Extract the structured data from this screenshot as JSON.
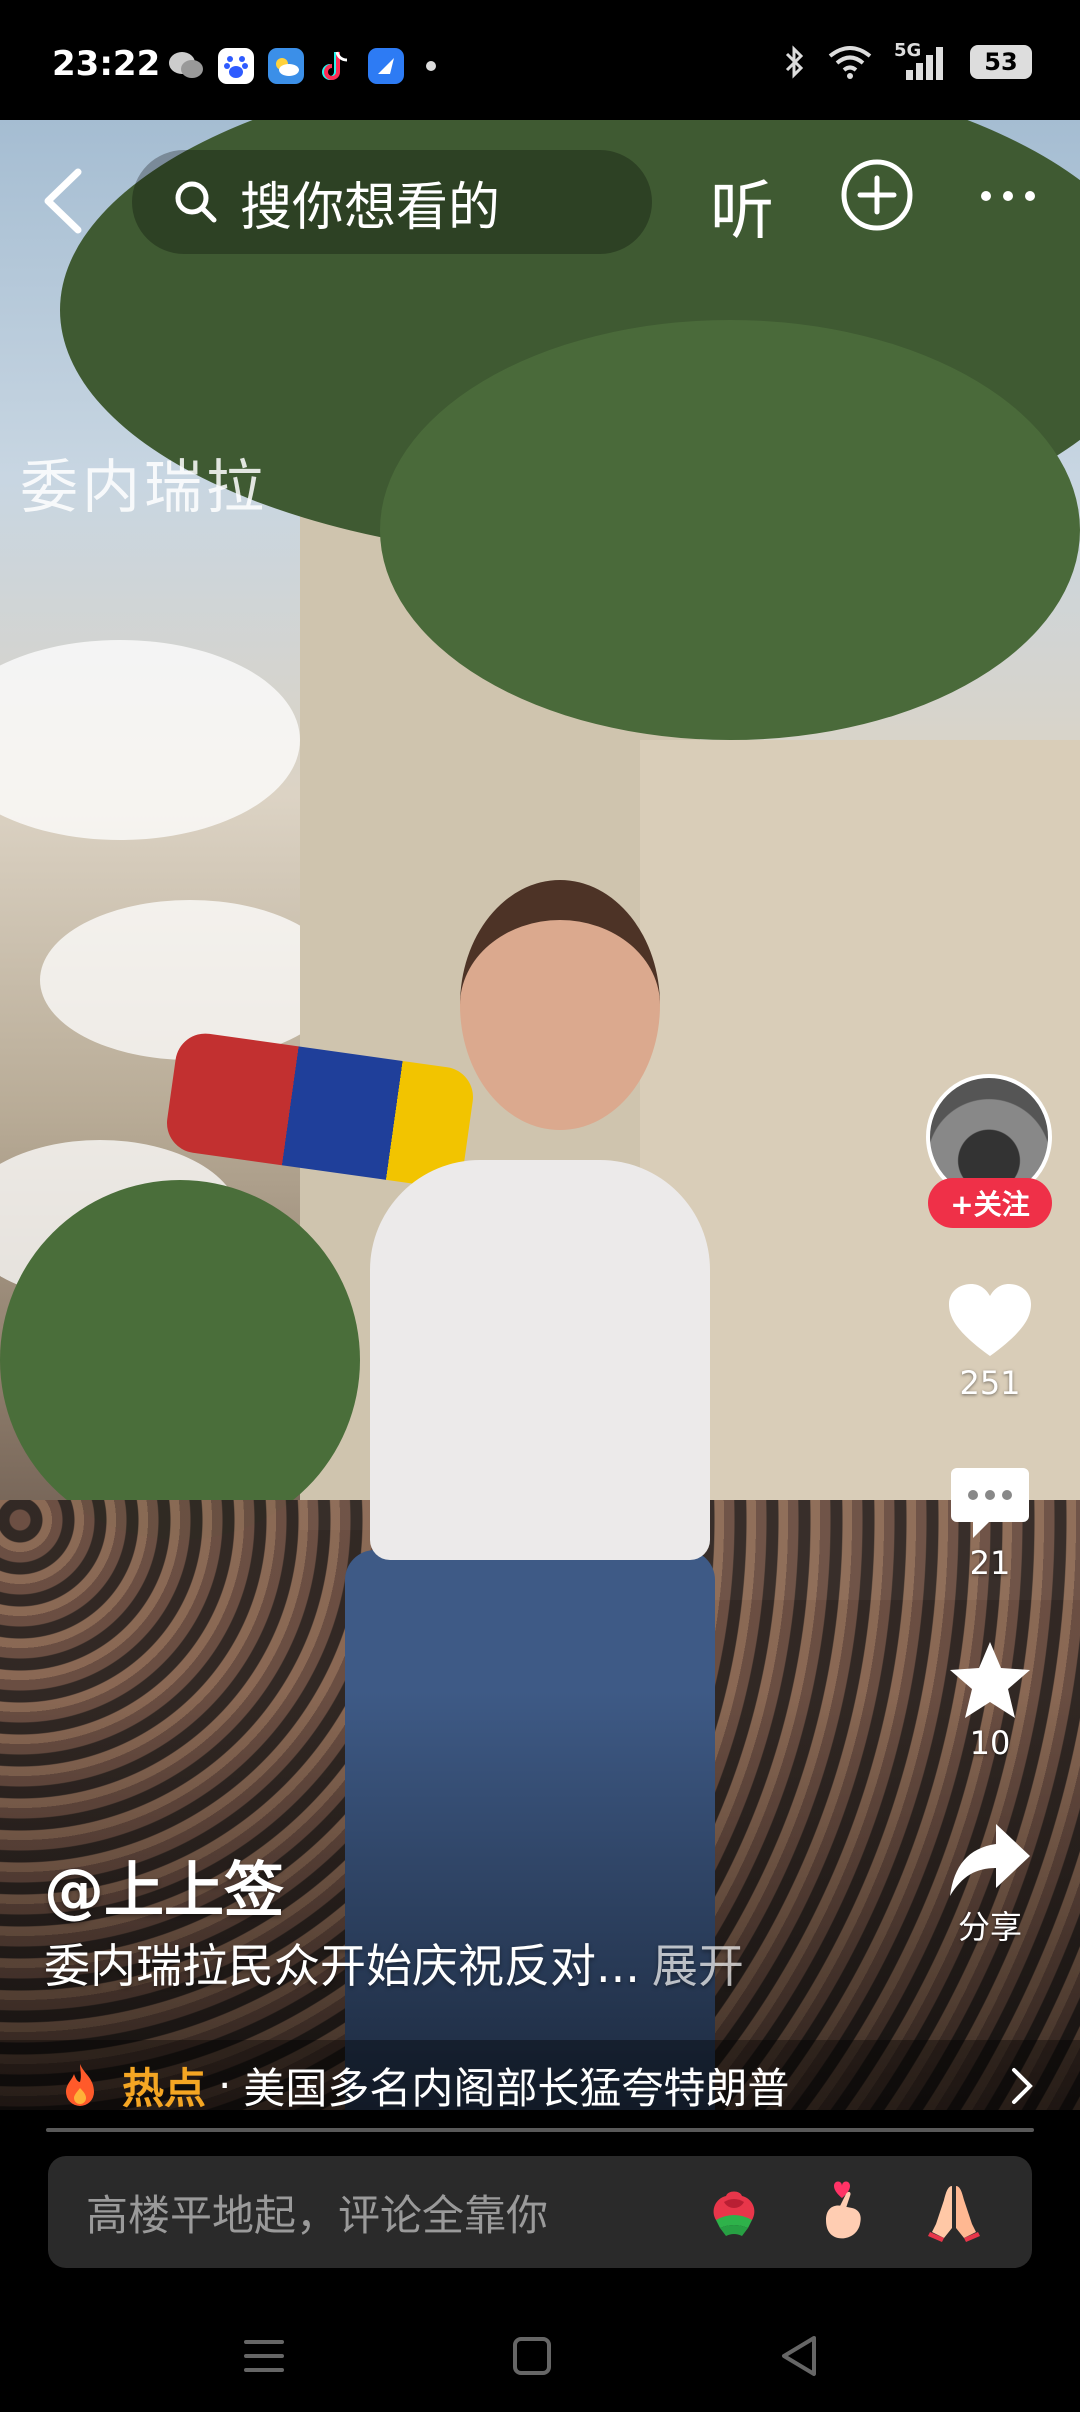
{
  "status_bar": {
    "time": "23:22",
    "network": "5G",
    "battery": "53",
    "apps": [
      "wechat-icon",
      "baidu-icon",
      "weather-icon",
      "tiktok-icon",
      "browser-icon"
    ]
  },
  "top_bar": {
    "search_placeholder": "搜你想看的",
    "listen_label": "听"
  },
  "video": {
    "watermark": "委内瑞拉"
  },
  "right_rail": {
    "follow_label": "+关注",
    "likes": "251",
    "comments": "21",
    "favorites": "10",
    "share_label": "分享"
  },
  "post": {
    "author": "@上上签",
    "description": "委内瑞拉民众开始庆祝反对...",
    "expand_label": "展开"
  },
  "hot_topic": {
    "label": "热点",
    "separator": "·",
    "text": "美国多名内阁部长猛夸特朗普"
  },
  "comment_bar": {
    "placeholder": "高楼平地起，评论全靠你",
    "emojis": [
      "rose-emoji",
      "finger-heart-emoji",
      "praying-hands-emoji"
    ]
  },
  "colors": {
    "follow_red": "#ef3048",
    "hot_orange": "#f5a623"
  }
}
